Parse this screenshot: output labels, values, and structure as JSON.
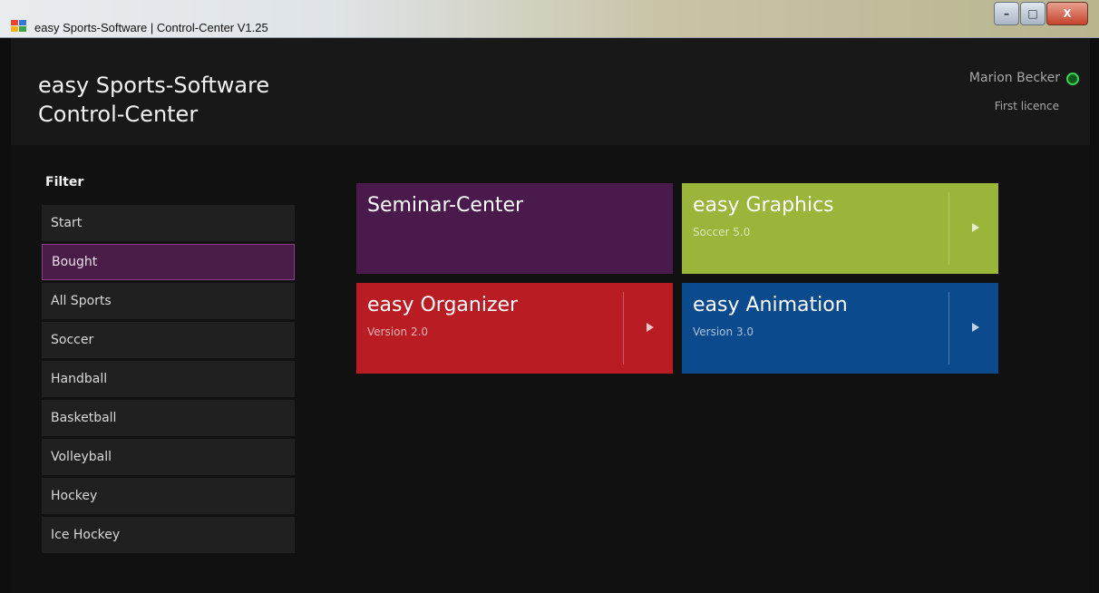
{
  "window": {
    "title": "easy Sports-Software | Control-Center V1.25",
    "minimize_glyph": "–",
    "maximize_glyph": "□",
    "close_glyph": "X"
  },
  "header": {
    "title_line1": "easy Sports-Software",
    "title_line2": "Control-Center",
    "user_name": "Marion Becker",
    "licence": "First licence"
  },
  "sidebar": {
    "filter_label": "Filter",
    "items": [
      {
        "label": "Start"
      },
      {
        "label": "Bought"
      },
      {
        "label": "All Sports"
      },
      {
        "label": "Soccer"
      },
      {
        "label": "Handball"
      },
      {
        "label": "Basketball"
      },
      {
        "label": "Volleyball"
      },
      {
        "label": "Hockey"
      },
      {
        "label": "Ice Hockey"
      }
    ],
    "active_item": "Bought"
  },
  "tiles": [
    {
      "title": "Seminar-Center",
      "subtitle": "",
      "color": "#4a1a4c"
    },
    {
      "title": "easy Graphics",
      "subtitle": "Soccer 5.0",
      "color": "#9ab53a"
    },
    {
      "title": "easy Organizer",
      "subtitle": "Version 2.0",
      "color": "#b91c23"
    },
    {
      "title": "easy Animation",
      "subtitle": "Version 3.0",
      "color": "#0b4a8c"
    }
  ]
}
